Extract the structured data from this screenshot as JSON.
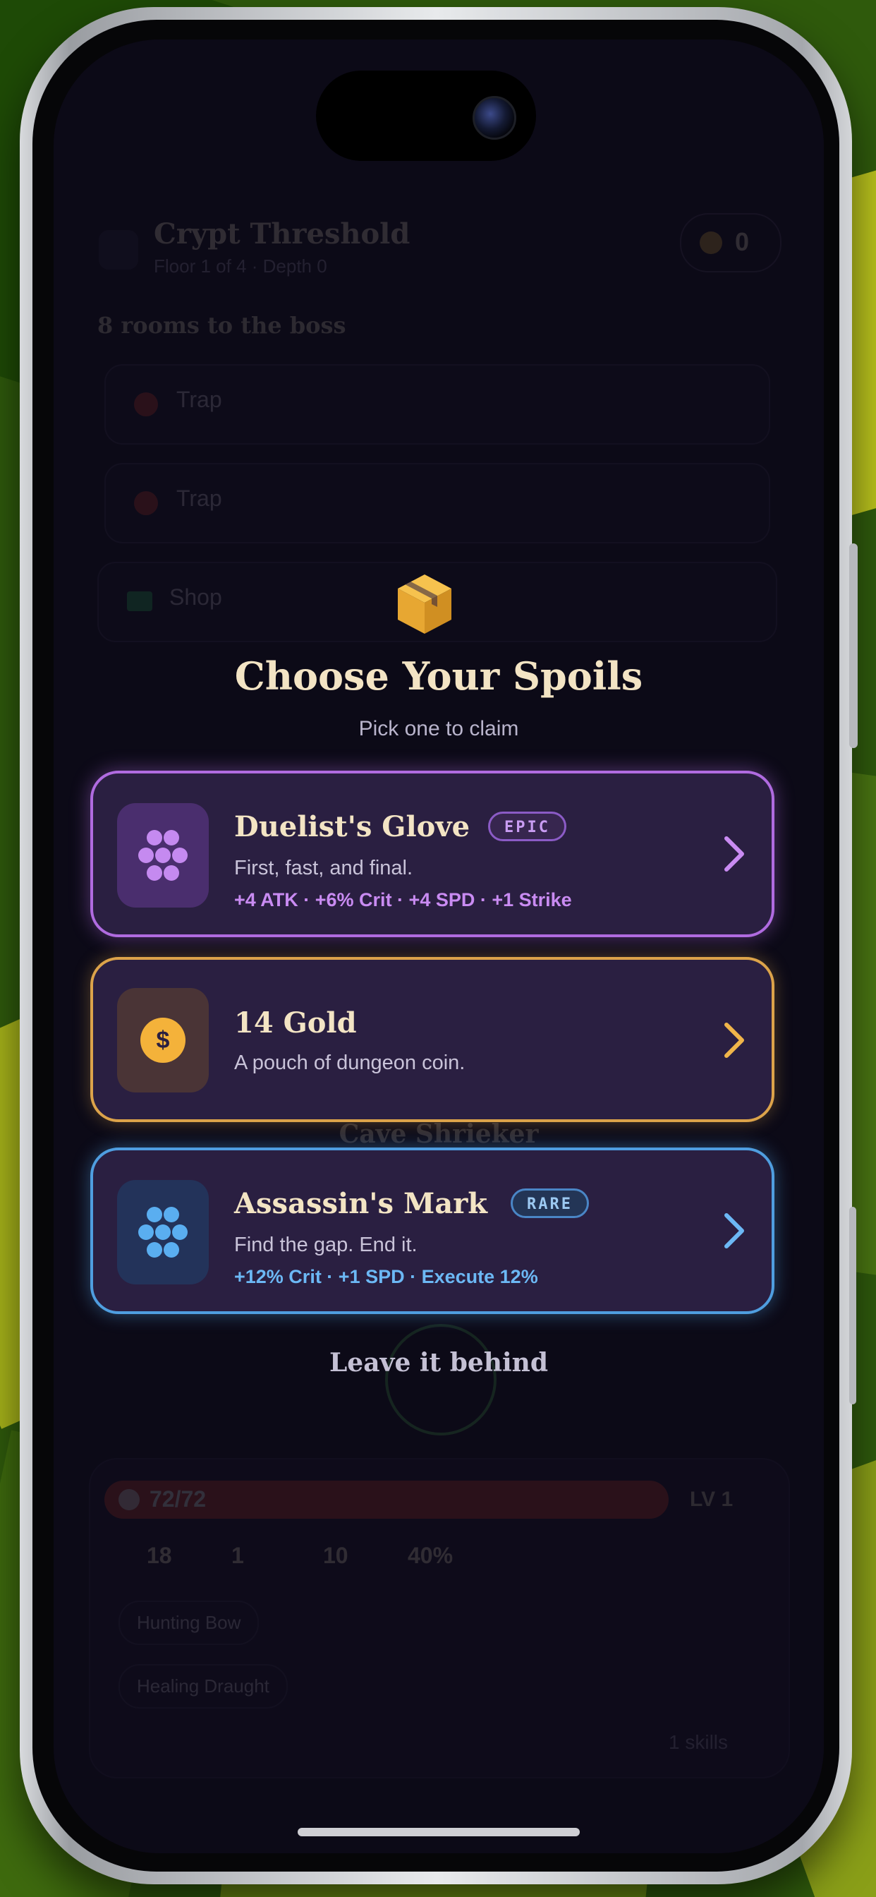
{
  "header": {
    "dungeon_name": "Crypt Threshold",
    "floor_info": "Floor 1 of 4 · Depth 0",
    "gold_count": "0"
  },
  "path": {
    "rooms_to_boss": "8 rooms to the boss",
    "rooms": [
      {
        "label": "Trap",
        "icon": "spike-icon"
      },
      {
        "label": "Trap",
        "icon": "spike-icon"
      },
      {
        "label": "Shop",
        "icon": "cart-icon"
      }
    ]
  },
  "encounter": {
    "enemy_name": "Cave Shrieker"
  },
  "player": {
    "hp": "72/72",
    "hp_fraction": 1.0,
    "level": "LV 1",
    "stats": {
      "atk": "18",
      "def": "1",
      "spd": "10",
      "crit": "40%"
    },
    "weapon": "Hunting Bow",
    "consumable": "Healing Draught",
    "skills": "1 skills"
  },
  "modal": {
    "title": "Choose Your Spoils",
    "subtitle": "Pick one to claim",
    "options": [
      {
        "name": "Duelist's Glove",
        "rarity": "EPIC",
        "description": "First, fast, and final.",
        "stats": "+4 ATK · +6% Crit · +4 SPD · +1 Strike",
        "icon": "rune-cluster-icon",
        "accent": "#b06be0"
      },
      {
        "name": "14 Gold",
        "description": "A pouch of dungeon coin.",
        "icon": "gold-coin-icon",
        "accent": "#dca34a"
      },
      {
        "name": "Assassin's Mark",
        "rarity": "RARE",
        "description": "Find the gap. End it.",
        "stats": "+12% Crit · +1 SPD · Execute 12%",
        "icon": "rune-cluster-icon",
        "accent": "#4f9ee0"
      }
    ],
    "leave_label": "Leave it behind"
  },
  "colors": {
    "epic": "#b06be0",
    "gold": "#dca34a",
    "rare": "#4f9ee0",
    "title_cream": "#f3e4c4",
    "screen_bg": "#100d1d"
  }
}
